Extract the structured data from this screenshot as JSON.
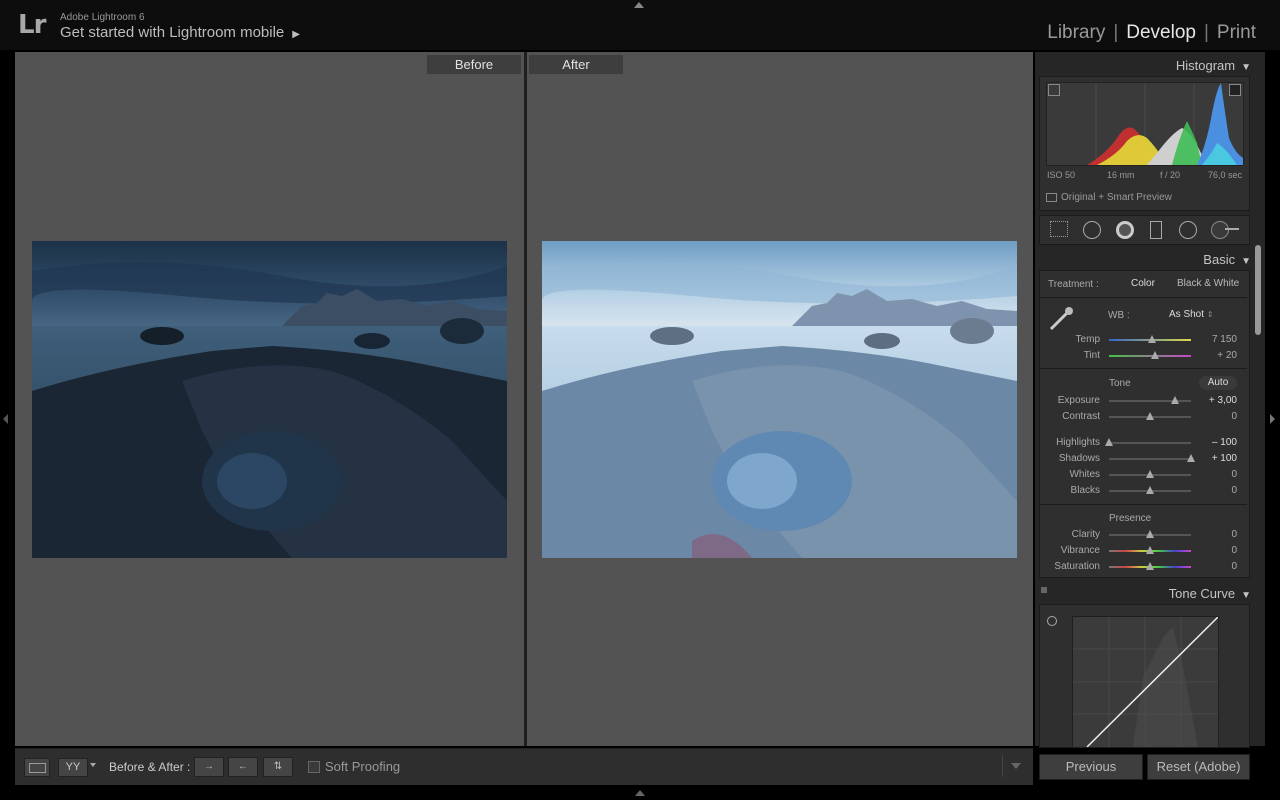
{
  "app": {
    "logo": "Lr",
    "name": "Adobe Lightroom 6",
    "mobile_link": "Get started with Lightroom mobile",
    "mobile_arrow": "▶"
  },
  "modules": {
    "library": "Library",
    "develop": "Develop",
    "print": "Print",
    "sep": "|"
  },
  "view": {
    "before_label": "Before",
    "after_label": "After"
  },
  "toolbar": {
    "yy_label": "YY",
    "before_after_label": "Before & After :",
    "swap1": "→",
    "swap2": "←",
    "swap3": "⇅",
    "soft_proofing": "Soft Proofing"
  },
  "histogram": {
    "title": "Histogram",
    "iso": "ISO 50",
    "focal": "16 mm",
    "aperture": "f / 20",
    "shutter": "76,0 sec",
    "preview": "Original + Smart Preview"
  },
  "basic": {
    "title": "Basic",
    "treatment_label": "Treatment :",
    "color": "Color",
    "bw": "Black & White",
    "wb_label": "WB :",
    "wb_value": "As Shot",
    "wb_arrows": "⇕",
    "tone_title": "Tone",
    "auto": "Auto",
    "presence_title": "Presence",
    "sliders": {
      "temp": {
        "label": "Temp",
        "value": "7 150",
        "level": 0.52
      },
      "tint": {
        "label": "Tint",
        "value": "+ 20",
        "level": 0.56
      },
      "exposure": {
        "label": "Exposure",
        "value": "+ 3,00",
        "level": 0.8
      },
      "contrast": {
        "label": "Contrast",
        "value": "0",
        "level": 0.5
      },
      "highlights": {
        "label": "Highlights",
        "value": "– 100",
        "level": 0.0
      },
      "shadows": {
        "label": "Shadows",
        "value": "+ 100",
        "level": 1.0
      },
      "whites": {
        "label": "Whites",
        "value": "0",
        "level": 0.5
      },
      "blacks": {
        "label": "Blacks",
        "value": "0",
        "level": 0.5
      },
      "clarity": {
        "label": "Clarity",
        "value": "0",
        "level": 0.5
      },
      "vibrance": {
        "label": "Vibrance",
        "value": "0",
        "level": 0.5
      },
      "saturation": {
        "label": "Saturation",
        "value": "0",
        "level": 0.5
      }
    }
  },
  "tone_curve": {
    "title": "Tone Curve"
  },
  "buttons": {
    "previous": "Previous",
    "reset": "Reset (Adobe)"
  },
  "icons": {
    "triangle": "▼"
  }
}
